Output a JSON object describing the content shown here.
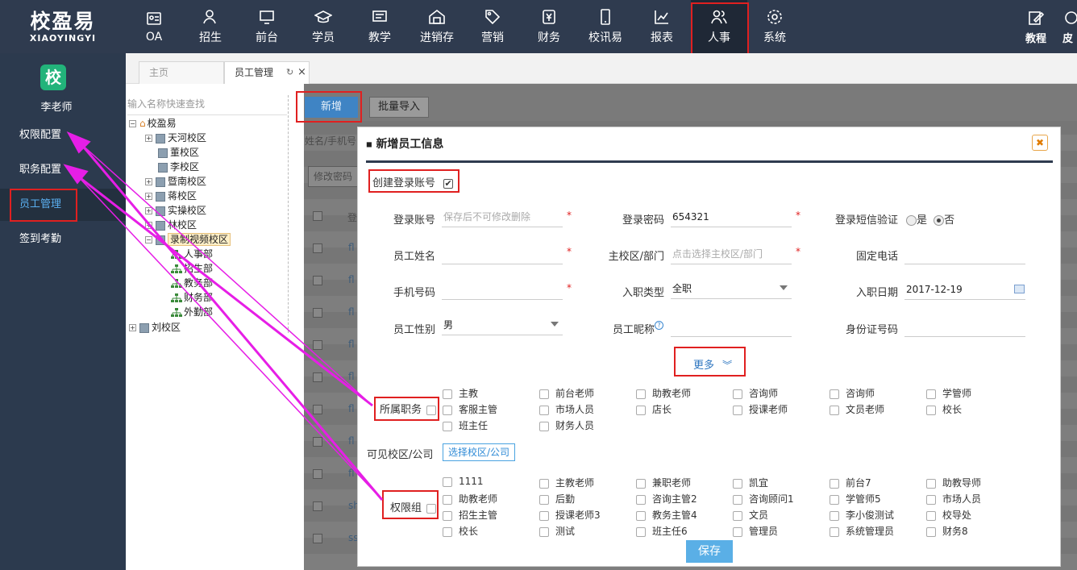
{
  "brand": {
    "name_cn": "校盈易",
    "name_en": "XIAOYINGYI"
  },
  "nav": [
    {
      "label": "OA",
      "icon": "id-card-icon"
    },
    {
      "label": "招生",
      "icon": "user-add-icon"
    },
    {
      "label": "前台",
      "icon": "monitor-icon"
    },
    {
      "label": "学员",
      "icon": "graduation-cap-icon"
    },
    {
      "label": "教学",
      "icon": "board-icon"
    },
    {
      "label": "进销存",
      "icon": "warehouse-icon"
    },
    {
      "label": "营销",
      "icon": "tag-icon"
    },
    {
      "label": "财务",
      "icon": "yen-icon"
    },
    {
      "label": "校讯易",
      "icon": "phone-icon"
    },
    {
      "label": "报表",
      "icon": "chart-icon"
    },
    {
      "label": "人事",
      "icon": "users-icon"
    },
    {
      "label": "系统",
      "icon": "gear-icon"
    }
  ],
  "nav_right": {
    "label": "教程",
    "label2": "皮"
  },
  "sidebar": {
    "avatar": "校",
    "user": "李老师",
    "items": [
      "权限配置",
      "职务配置",
      "员工管理",
      "签到考勤"
    ]
  },
  "tabs": [
    {
      "label": "主页"
    },
    {
      "label": "员工管理"
    }
  ],
  "tree": {
    "search_placeholder": "输入名称快速查找",
    "root": "校盈易",
    "nodes": [
      "天河校区",
      "董校区",
      "李校区",
      "暨南校区",
      "蒋校区",
      "实操校区",
      "林校区",
      "录制视频校区",
      "人事部",
      "招生部",
      "教务部",
      "财务部",
      "外勤部",
      "刘校区"
    ]
  },
  "toolbar": {
    "new": "新增",
    "import": "批量导入"
  },
  "ghost": {
    "search": "姓名/手机号",
    "pwd": "修改密码",
    "col": "登",
    "rows": [
      "fl",
      "fl",
      "fl",
      "fl",
      "fl",
      "fl",
      "fl",
      "fl",
      "sh",
      "ss"
    ]
  },
  "modal": {
    "title": "新增员工信息",
    "create_account": "创建登录账号",
    "fields": {
      "account_label": "登录账号",
      "account_placeholder": "保存后不可修改删除",
      "password_label": "登录密码",
      "password_value": "654321",
      "sms_label": "登录短信验证",
      "sms_yes": "是",
      "sms_no": "否",
      "name_label": "员工姓名",
      "dept_label": "主校区/部门",
      "dept_placeholder": "点击选择主校区/部门",
      "tel_label": "固定电话",
      "mobile_label": "手机号码",
      "type_label": "入职类型",
      "type_value": "全职",
      "date_label": "入职日期",
      "date_value": "2017-12-19",
      "gender_label": "员工性别",
      "gender_value": "男",
      "nick_label": "员工昵称",
      "idcard_label": "身份证号码"
    },
    "more": "更多",
    "duty_label": "所属职务",
    "duties": [
      "主教",
      "前台老师",
      "助教老师",
      "咨询师",
      "咨询师",
      "学管师",
      "客服主管",
      "市场人员",
      "店长",
      "授课老师",
      "文员老师",
      "校长",
      "班主任",
      "财务人员"
    ],
    "visible_label": "可见校区/公司",
    "visible_button": "选择校区/公司",
    "role_label": "权限组",
    "roles": [
      "1111",
      "主教老师",
      "兼职老师",
      "凯宜",
      "前台7",
      "助教导师",
      "助教老师",
      "后勤",
      "咨询主管2",
      "咨询顾问1",
      "学管师5",
      "市场人员",
      "招生主管",
      "授课老师3",
      "教务主管4",
      "文员",
      "李小俊测试",
      "校导处",
      "校长",
      "测试",
      "班主任6",
      "管理员",
      "系统管理员",
      "财务8"
    ],
    "save": "保存"
  }
}
